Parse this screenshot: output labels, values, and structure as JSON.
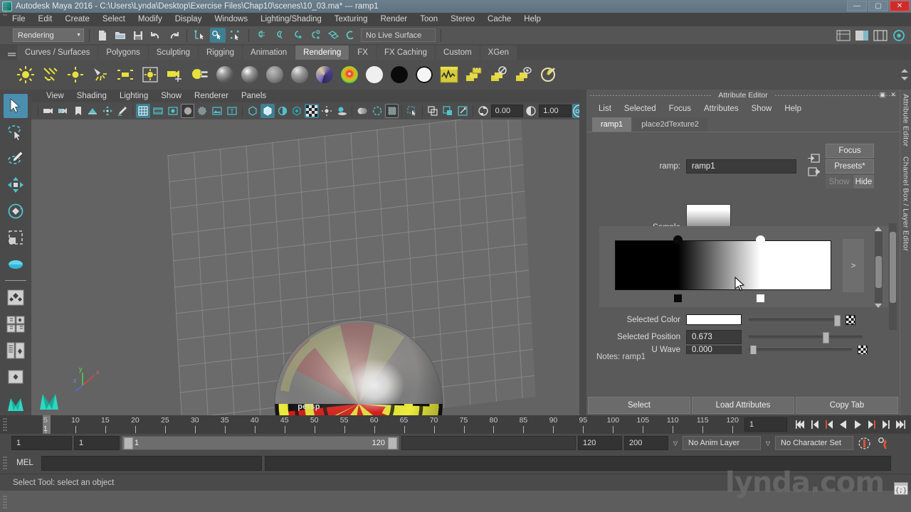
{
  "window": {
    "title": "Autodesk Maya 2016 - C:\\Users\\Lynda\\Desktop\\Exercise Files\\Chap10\\scenes\\10_03.ma*   ---   ramp1",
    "minimize": "—",
    "maximize": "▢",
    "close": "✕"
  },
  "menubar": {
    "items": [
      {
        "label": "File"
      },
      {
        "label": "Edit"
      },
      {
        "label": "Create"
      },
      {
        "label": "Select"
      },
      {
        "label": "Modify"
      },
      {
        "label": "Display"
      },
      {
        "label": "Windows"
      },
      {
        "label": "Lighting/Shading"
      },
      {
        "label": "Texturing"
      },
      {
        "label": "Render"
      },
      {
        "label": "Toon"
      },
      {
        "label": "Stereo"
      },
      {
        "label": "Cache"
      },
      {
        "label": "Help"
      }
    ]
  },
  "statusline": {
    "menuset": "Rendering",
    "menuset_arrow": "▼",
    "live_surface": "No Live Surface"
  },
  "shelf": {
    "tabs": [
      {
        "label": "Curves / Surfaces",
        "active": false
      },
      {
        "label": "Polygons",
        "active": false
      },
      {
        "label": "Sculpting",
        "active": false
      },
      {
        "label": "Rigging",
        "active": false
      },
      {
        "label": "Animation",
        "active": false
      },
      {
        "label": "Rendering",
        "active": true
      },
      {
        "label": "FX",
        "active": false
      },
      {
        "label": "FX Caching",
        "active": false
      },
      {
        "label": "Custom",
        "active": false
      },
      {
        "label": "XGen",
        "active": false
      }
    ],
    "icons": [
      "point-light-icon",
      "directional-light-icon",
      "ambient-light-icon",
      "spot-light-icon",
      "area-light-icon",
      "volume-light-icon",
      "camera-icon",
      "render-settings-icon",
      "blinn-material-icon",
      "phong-material-icon",
      "lambert-material-icon",
      "anisotropic-material-icon",
      "layered-shader-icon",
      "ramp-shader-icon",
      "surface-shader-icon",
      "use-background-icon",
      "shading-map-icon",
      "hypershade-icon",
      "render-view-icon",
      "batch-render-icon",
      "ipr-render-icon",
      "render-current-frame-icon"
    ]
  },
  "toolbox": {
    "tools": [
      {
        "name": "select-tool",
        "active": true
      },
      {
        "name": "lasso-select-tool",
        "active": false
      },
      {
        "name": "paint-select-tool",
        "active": false
      },
      {
        "name": "move-tool",
        "active": false
      },
      {
        "name": "rotate-tool",
        "active": false
      },
      {
        "name": "scale-tool",
        "active": false
      },
      {
        "name": "last-tool-used",
        "active": false
      }
    ],
    "layouts": [
      "single-perspective-layout",
      "four-view-layout",
      "outliner-persp-layout",
      "hypergraph-persp-layout",
      "persp-graph-layout"
    ]
  },
  "viewport": {
    "menus": [
      {
        "label": "View"
      },
      {
        "label": "Shading"
      },
      {
        "label": "Lighting"
      },
      {
        "label": "Show"
      },
      {
        "label": "Renderer"
      },
      {
        "label": "Panels"
      }
    ],
    "exposure_value": "0.00",
    "gamma_value": "1.00",
    "gamma_toggle": "ON",
    "camera_label": "persp",
    "axis": {
      "x": "x",
      "y": "y",
      "z": "z"
    }
  },
  "attribute_editor": {
    "panel_title": "Attribute Editor",
    "dock_icon": "▣",
    "close_icon": "✕",
    "menus": [
      {
        "label": "List"
      },
      {
        "label": "Selected"
      },
      {
        "label": "Focus"
      },
      {
        "label": "Attributes"
      },
      {
        "label": "Show"
      },
      {
        "label": "Help"
      }
    ],
    "tabs": [
      {
        "label": "ramp1",
        "active": true
      },
      {
        "label": "place2dTexture2",
        "active": false
      }
    ],
    "node_label": "ramp:",
    "node_name": "ramp1",
    "focus_button": "Focus",
    "presets_button": "Presets*",
    "show_button": "Show",
    "hide_button": "Hide",
    "sample_label": "Sample",
    "ramp_expand": ">",
    "attributes": [
      {
        "label": "Selected Color",
        "type": "color",
        "value": "#ffffff"
      },
      {
        "label": "Selected Position",
        "type": "number",
        "value": "0.673",
        "slider_pct": 67.3
      },
      {
        "label": "U Wave",
        "type": "number",
        "value": "0.000",
        "slider_pct": 2
      }
    ],
    "notes_label": "Notes: ramp1",
    "bottom_buttons": [
      {
        "label": "Select"
      },
      {
        "label": "Load Attributes"
      },
      {
        "label": "Copy Tab"
      }
    ],
    "side_labels": [
      "Attribute Editor",
      "Channel Box / Layer Editor"
    ]
  },
  "ramp_widget": {
    "entries": [
      {
        "position": 0.29,
        "color": "#000000",
        "selected": false
      },
      {
        "position": 0.673,
        "color": "#ffffff",
        "selected": true
      }
    ],
    "gradient_css": "linear-gradient(to right, #000 0%, #000 29%, #ffffff 67.3%, #ffffff 100%)"
  },
  "timeline": {
    "ticks": [
      5,
      10,
      15,
      20,
      25,
      30,
      35,
      40,
      45,
      50,
      55,
      60,
      65,
      70,
      75,
      80,
      85,
      90,
      95,
      100,
      105,
      110,
      115,
      120
    ],
    "current_frame_marker": "1",
    "current_frame_field": "1",
    "playback_buttons": [
      "go-to-start-icon",
      "step-back-keyframe-icon",
      "step-back-frame-icon",
      "play-backwards-icon",
      "play-forwards-icon",
      "step-forward-frame-icon",
      "step-forward-keyframe-icon",
      "go-to-end-icon"
    ]
  },
  "range_slider": {
    "anim_start": "1",
    "range_start": "1",
    "slider_start_label": "1",
    "slider_end_label": "120",
    "range_end": "120",
    "anim_end": "200",
    "anim_layer": "No Anim Layer",
    "character_set": "No Character Set",
    "dropdown_arrow": "▽"
  },
  "command_line": {
    "language": "MEL",
    "input_value": "",
    "placeholder": ""
  },
  "status_bar": {
    "message": "Select Tool: select an object"
  },
  "watermark": {
    "text": "lynda.com"
  }
}
